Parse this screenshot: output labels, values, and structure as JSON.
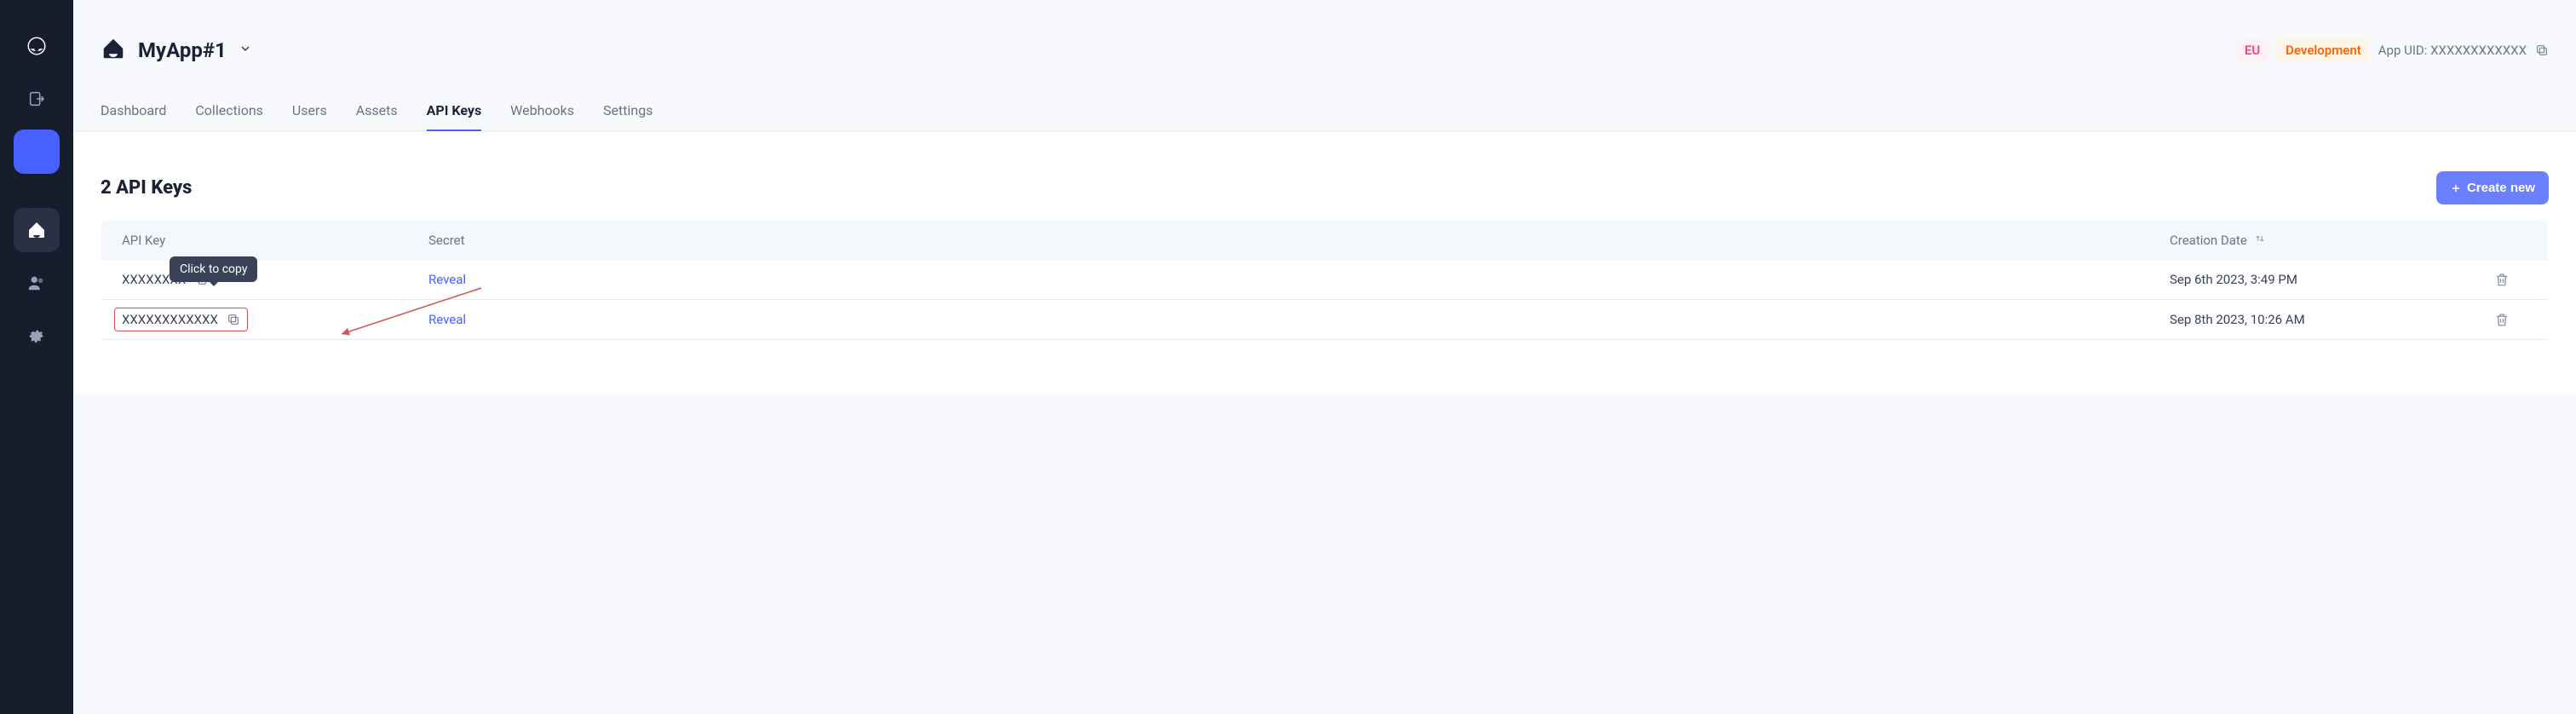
{
  "app": {
    "name": "MyApp#1",
    "uid_label": "App UID:",
    "uid_value": "XXXXXXXXXXXX",
    "region_badge": "EU",
    "env_badge": "Development"
  },
  "tabs": [
    {
      "label": "Dashboard",
      "active": false
    },
    {
      "label": "Collections",
      "active": false
    },
    {
      "label": "Users",
      "active": false
    },
    {
      "label": "Assets",
      "active": false
    },
    {
      "label": "API Keys",
      "active": true
    },
    {
      "label": "Webhooks",
      "active": false
    },
    {
      "label": "Settings",
      "active": false
    }
  ],
  "section": {
    "title": "2 API Keys",
    "create_label": "Create new"
  },
  "table": {
    "columns": {
      "key": "API Key",
      "secret": "Secret",
      "created": "Creation Date"
    },
    "reveal_label": "Reveal",
    "tooltip": "Click to copy",
    "rows": [
      {
        "key": "XXXXXXXX",
        "created": "Sep 6th 2023, 3:49 PM",
        "highlighted": false,
        "show_tooltip": true
      },
      {
        "key": "XXXXXXXXXXXX",
        "created": "Sep 8th 2023, 10:26 AM",
        "highlighted": true,
        "show_tooltip": false
      }
    ]
  }
}
